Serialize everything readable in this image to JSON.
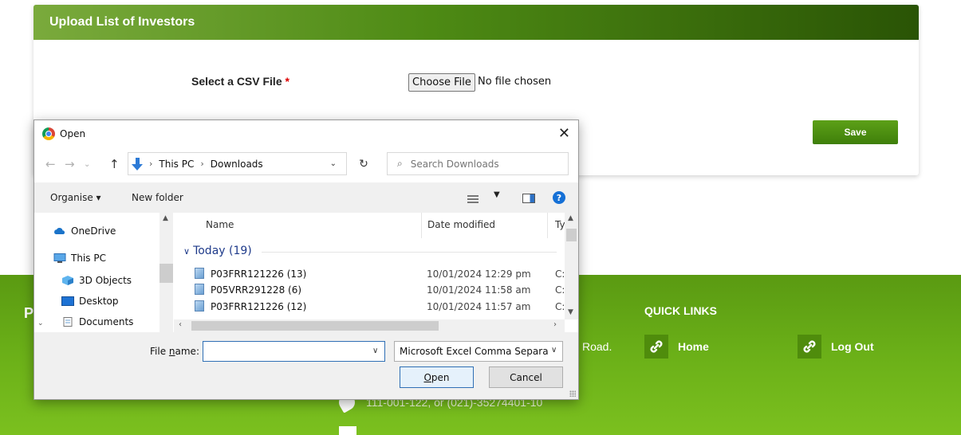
{
  "card": {
    "title": "Upload List of Investors",
    "field_label": "Select a CSV File",
    "required_mark": "*",
    "choose_file_label": "Choose File",
    "file_status": "No file chosen",
    "save_label": "Save"
  },
  "footer": {
    "partial_heading": "P",
    "address_tail": "Road.",
    "quick_links_title": "QUICK LINKS",
    "links": [
      {
        "label": "Home",
        "icon": "link-icon"
      },
      {
        "label": "Log Out",
        "icon": "link-icon"
      }
    ],
    "phone": "111-001-122, or (021)-35274401-10"
  },
  "dialog": {
    "title": "Open",
    "close_glyph": "✕",
    "path": [
      "This PC",
      "Downloads"
    ],
    "search_placeholder": "Search Downloads",
    "toolbar": {
      "organise": "Organise ▾",
      "new_folder": "New folder",
      "help": "?"
    },
    "nav_items": [
      {
        "label": "OneDrive",
        "icon": "onedrive-icon"
      },
      {
        "label": "This PC",
        "icon": "computer-icon"
      },
      {
        "label": "3D Objects",
        "icon": "cube-icon"
      },
      {
        "label": "Desktop",
        "icon": "desktop-icon"
      },
      {
        "label": "Documents",
        "icon": "documents-icon"
      }
    ],
    "columns": {
      "name": "Name",
      "date": "Date modified",
      "type": "Ty"
    },
    "group_label": "Today (19)",
    "files": [
      {
        "name": "P03FRR121226 (13)",
        "date": "10/01/2024 12:29 pm",
        "type": "C:"
      },
      {
        "name": "P05VRR291228 (6)",
        "date": "10/01/2024 11:58 am",
        "type": "C:"
      },
      {
        "name": "P03FRR121226 (12)",
        "date": "10/01/2024 11:57 am",
        "type": "C:"
      }
    ],
    "file_name_label_pre": "File ",
    "file_name_label_u": "n",
    "file_name_label_post": "ame:",
    "file_name_value": "",
    "file_type": "Microsoft Excel Comma Separa",
    "open_label_u": "O",
    "open_label_rest": "pen",
    "cancel_label": "Cancel"
  },
  "colors": {
    "accent_green": "#4d8a14",
    "footer_green": "#6bb018",
    "dialog_blue": "#2f6fb5"
  }
}
